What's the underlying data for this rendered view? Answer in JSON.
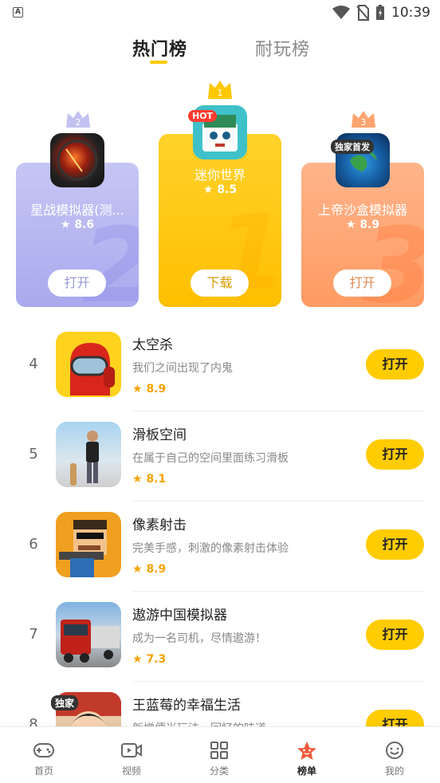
{
  "status": {
    "time": "10:39"
  },
  "tabs": [
    {
      "label": "热门榜"
    },
    {
      "label": "耐玩榜"
    }
  ],
  "podium": [
    {
      "rank": "2",
      "name": "星战模拟器(测...",
      "score": "8.6",
      "button": "打开"
    },
    {
      "rank": "1",
      "name": "迷你世界",
      "score": "8.5",
      "button": "下载",
      "badge": "HOT"
    },
    {
      "rank": "3",
      "name": "上帝沙盒模拟器",
      "score": "8.9",
      "button": "打开",
      "badge": "独家首发"
    }
  ],
  "list": [
    {
      "rank": "4",
      "title": "太空杀",
      "desc": "我们之间出现了内鬼",
      "score": "8.9",
      "button": "打开"
    },
    {
      "rank": "5",
      "title": "滑板空间",
      "desc": "在属于自己的空间里面练习滑板",
      "score": "8.1",
      "button": "打开"
    },
    {
      "rank": "6",
      "title": "像素射击",
      "desc": "完美手感，刺激的像素射击体验",
      "score": "8.9",
      "button": "打开"
    },
    {
      "rank": "7",
      "title": "遨游中国模拟器",
      "desc": "成为一名司机，尽情遨游！",
      "score": "7.3",
      "button": "打开"
    },
    {
      "rank": "8",
      "title": "王蓝莓的幸福生活",
      "desc": "新增便当玩法，回忆的味道~",
      "score": "",
      "button": "打开",
      "badge": "独家"
    }
  ],
  "nav": [
    {
      "label": "首页",
      "icon": "gamepad-icon"
    },
    {
      "label": "视频",
      "icon": "video-icon"
    },
    {
      "label": "分类",
      "icon": "grid-icon"
    },
    {
      "label": "榜单",
      "icon": "star-rank-icon"
    },
    {
      "label": "我的",
      "icon": "smile-icon"
    }
  ],
  "colors": {
    "accent": "#ffcc00",
    "score": "#f5a300",
    "rank2": "#b3b3f0",
    "rank1": "#ffc800",
    "rank3": "#ffa46e"
  }
}
